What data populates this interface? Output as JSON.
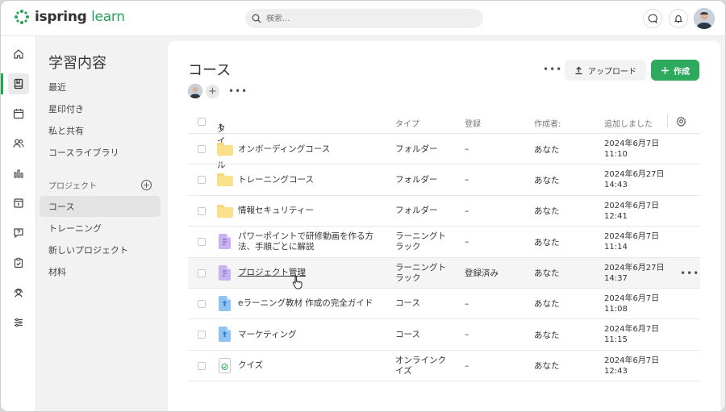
{
  "brand": {
    "logo_text_1": "ispring",
    "logo_text_2": "learn",
    "accent": "#27a456"
  },
  "search": {
    "placeholder": "検索..."
  },
  "topbar_icons": [
    "chat-icon",
    "bell-icon",
    "user-avatar"
  ],
  "rail": [
    {
      "name": "home-icon"
    },
    {
      "name": "book-icon",
      "active": true
    },
    {
      "name": "calendar-icon"
    },
    {
      "name": "users-icon"
    },
    {
      "name": "bar-chart-icon"
    },
    {
      "name": "info-board-icon"
    },
    {
      "name": "question-chat-icon"
    },
    {
      "name": "clipboard-check-icon"
    },
    {
      "name": "support-agent-icon"
    },
    {
      "name": "sliders-icon"
    }
  ],
  "sidebar": {
    "title": "学習内容",
    "items": [
      "最近",
      "星印付き",
      "私と共有",
      "コースライブラリ"
    ],
    "section": "プロジェクト",
    "projects": [
      "コース",
      "トレーニング",
      "新しいプロジェクト",
      "材料"
    ],
    "active_project": "コース"
  },
  "main": {
    "title": "コース",
    "upload_label": "アップロード",
    "create_label": "作成",
    "columns": {
      "title": "タイトル",
      "type": "タイプ",
      "registration": "登録",
      "author": "作成者:",
      "added": "追加しました"
    },
    "rows": [
      {
        "icon": "folder",
        "name": "オンボーディングコース",
        "type": "フォルダー",
        "reg": "–",
        "author": "あなた",
        "date": "2024年6月7日",
        "time": "11:10"
      },
      {
        "icon": "folder",
        "name": "トレーニングコース",
        "type": "フォルダー",
        "reg": "–",
        "author": "あなた",
        "date": "2024年6月27日",
        "time": "14:43"
      },
      {
        "icon": "folder",
        "name": "情報セキュリティー",
        "type": "フォルダー",
        "reg": "–",
        "author": "あなた",
        "date": "2024年6月7日",
        "time": "12:41"
      },
      {
        "icon": "track",
        "name": "パワーポイントで研修動画を作る方法、手順ごとに解説",
        "type": "ラーニングトラック",
        "reg": "–",
        "author": "あなた",
        "date": "2024年6月7日",
        "time": "11:14"
      },
      {
        "icon": "track",
        "name": "プロジェクト管理",
        "type": "ラーニングトラック",
        "reg": "登録済み",
        "author": "あなた",
        "date": "2024年6月27日",
        "time": "14:37"
      },
      {
        "icon": "course",
        "name": "eラーニング教材 作成の完全ガイド",
        "type": "コース",
        "reg": "–",
        "author": "あなた",
        "date": "2024年6月7日",
        "time": "11:08"
      },
      {
        "icon": "course",
        "name": "マーケティング",
        "type": "コース",
        "reg": "–",
        "author": "あなた",
        "date": "2024年6月7日",
        "time": "11:15"
      },
      {
        "icon": "quiz",
        "name": "クイズ",
        "type": "オンラインクイズ",
        "reg": "–",
        "author": "あなた",
        "date": "2024年6月7日",
        "time": "12:43"
      }
    ]
  }
}
